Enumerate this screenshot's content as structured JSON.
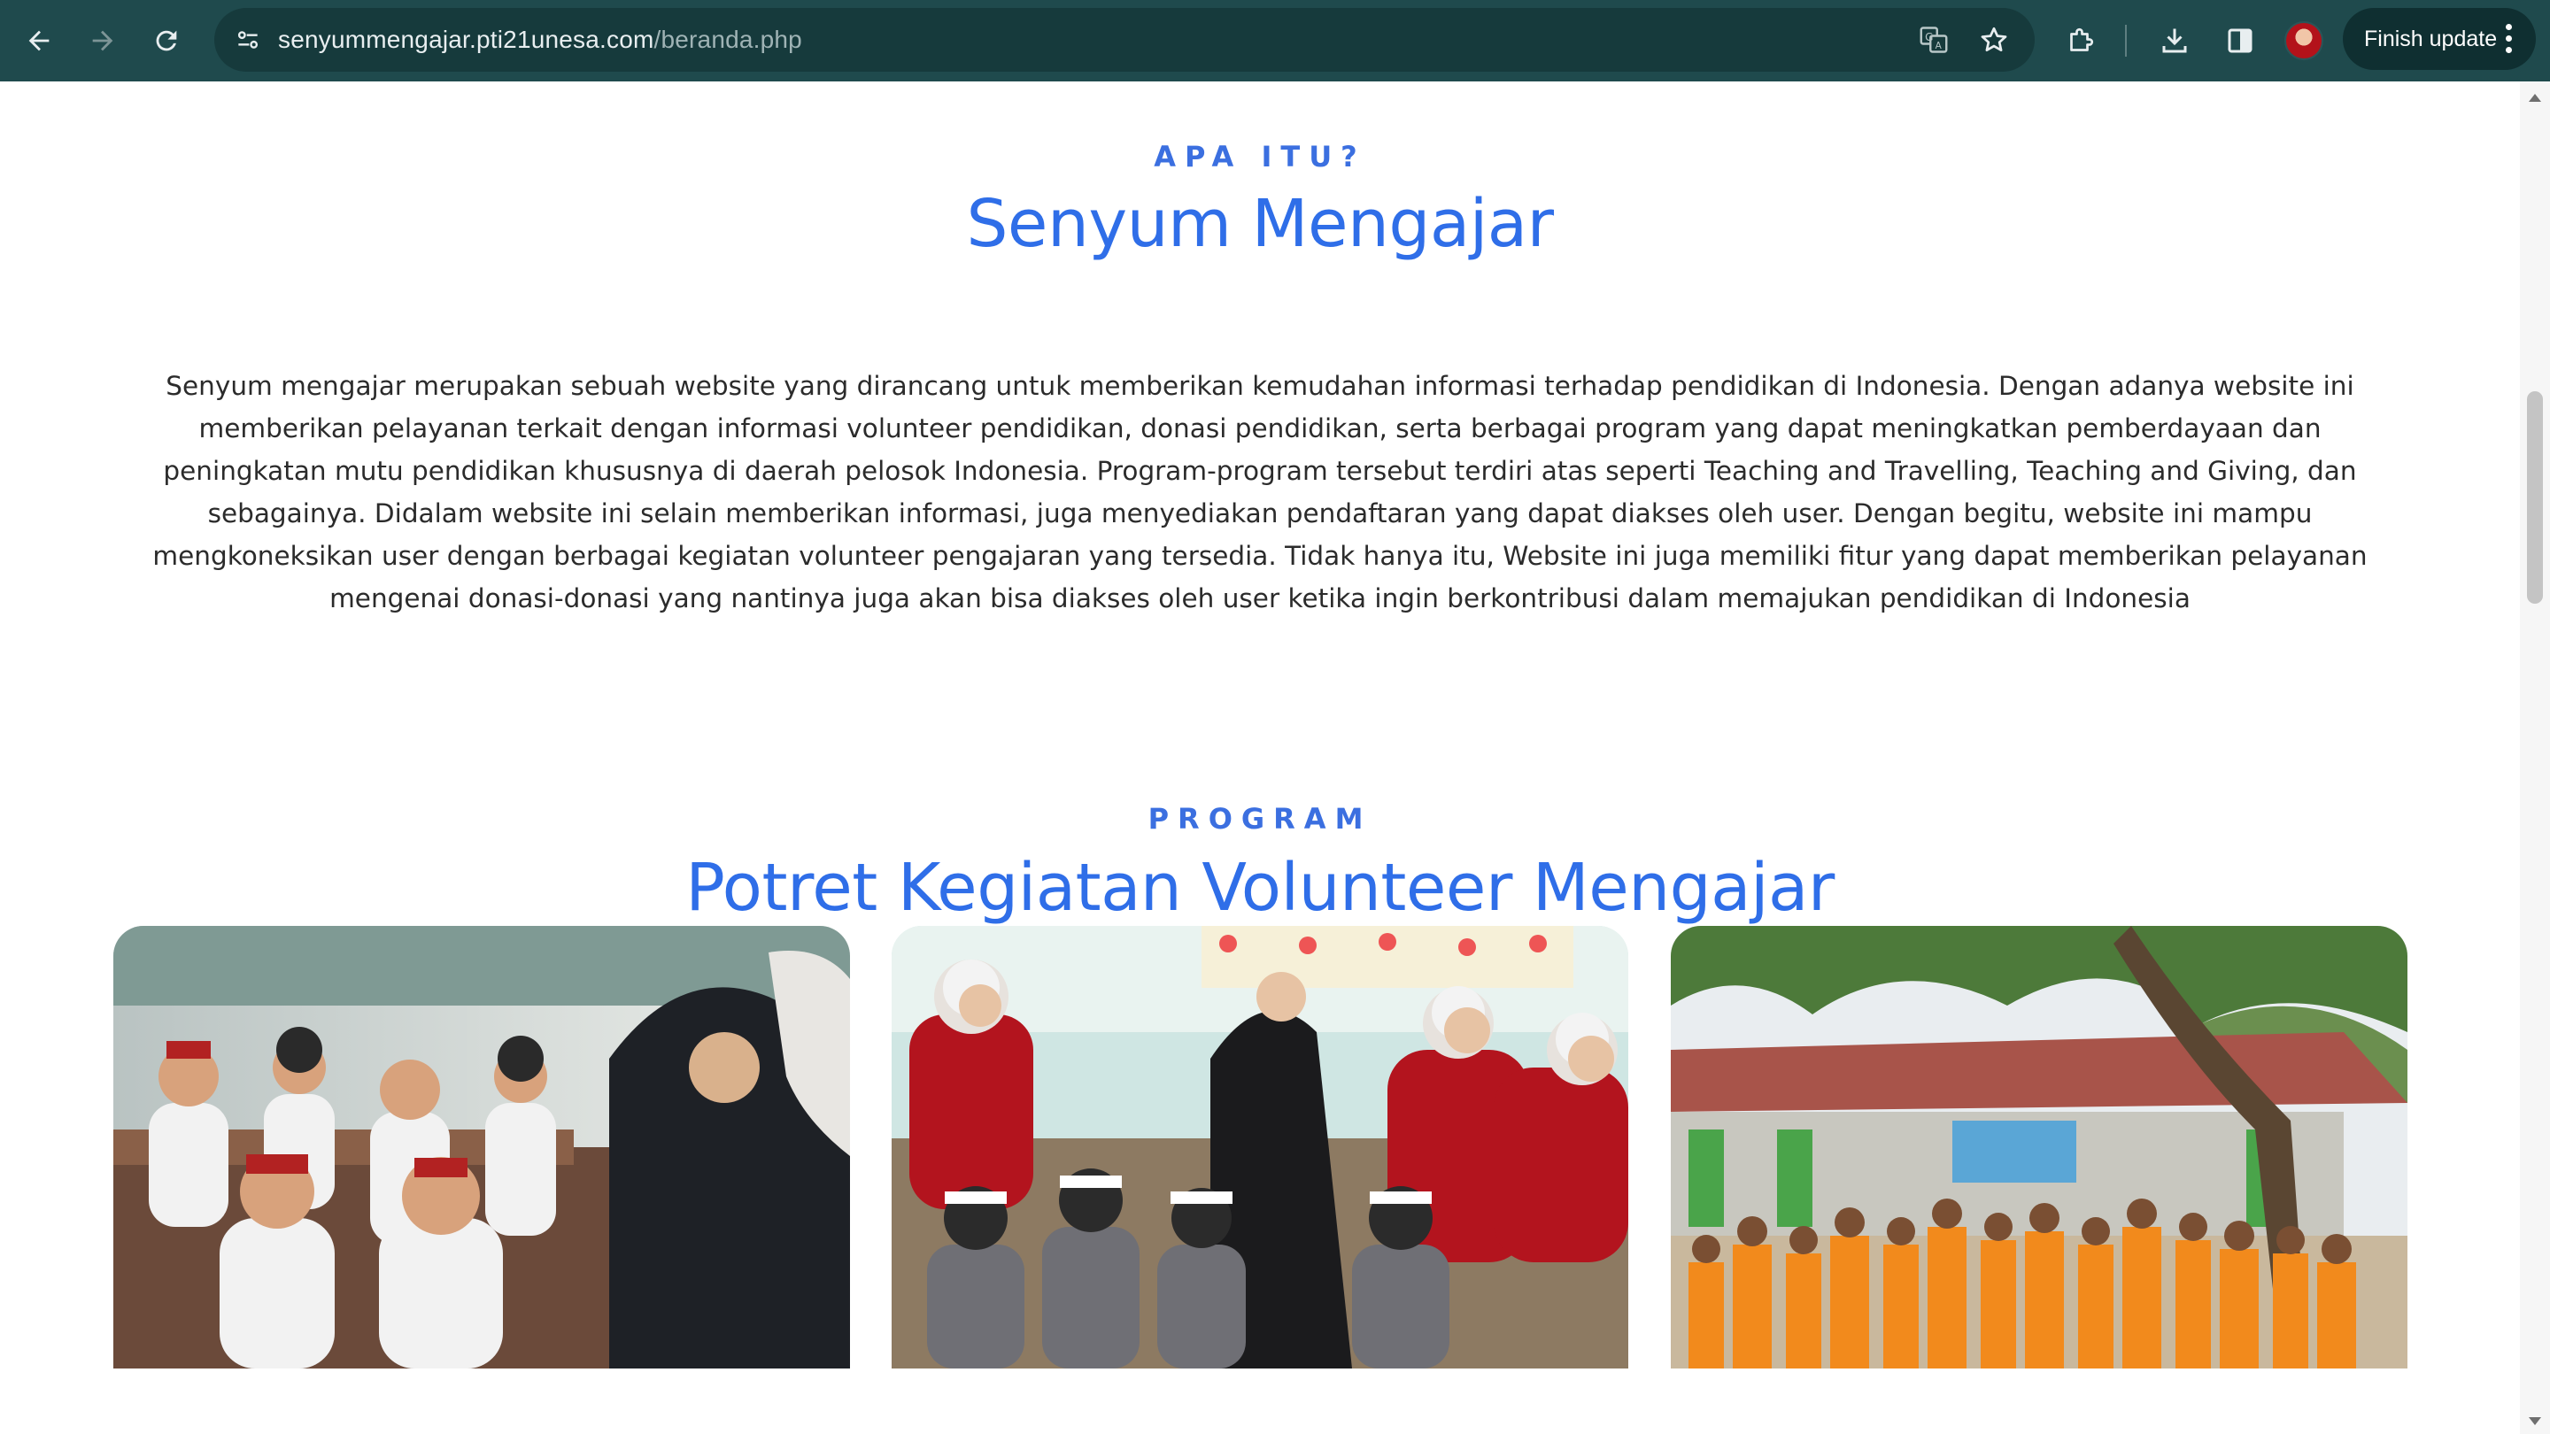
{
  "browser": {
    "url_domain": "senyummengajar.pti21unesa.com",
    "url_path": "/beranda.php",
    "update_button_label": "Finish update",
    "colors": {
      "toolbar": "#1f4a4d",
      "omnibox": "#163a3c"
    }
  },
  "about": {
    "eyebrow": "APA ITU?",
    "title": "Senyum Mengajar",
    "description": "Senyum mengajar merupakan sebuah website yang dirancang untuk memberikan kemudahan informasi terhadap pendidikan di Indonesia. Dengan adanya website ini memberikan pelayanan terkait dengan informasi volunteer pendidikan, donasi pendidikan, serta berbagai program yang dapat meningkatkan pemberdayaan dan peningkatan mutu pendidikan khususnya di daerah pelosok Indonesia. Program-program tersebut terdiri atas seperti Teaching and Travelling, Teaching and Giving, dan sebagainya. Didalam website ini selain memberikan informasi, juga menyediakan pendaftaran yang dapat diakses oleh user. Dengan begitu, website ini mampu mengkoneksikan user dengan berbagai kegiatan volunteer pengajaran yang tersedia. Tidak hanya itu, Website ini juga memiliki fitur yang dapat memberikan pelayanan mengenai donasi-donasi yang nantinya juga akan bisa diakses oleh user ketika ingin berkontribusi dalam memajukan pendidikan di Indonesia"
  },
  "program": {
    "eyebrow": "PROGRAM",
    "title": "Potret Kegiatan Volunteer Mengajar",
    "photos": [
      {
        "icon": "classroom-photo"
      },
      {
        "icon": "volunteers-photo"
      },
      {
        "icon": "school-yard-photo"
      }
    ]
  },
  "theme": {
    "accent": "#2f6ee8",
    "text": "#2b2b2b"
  }
}
